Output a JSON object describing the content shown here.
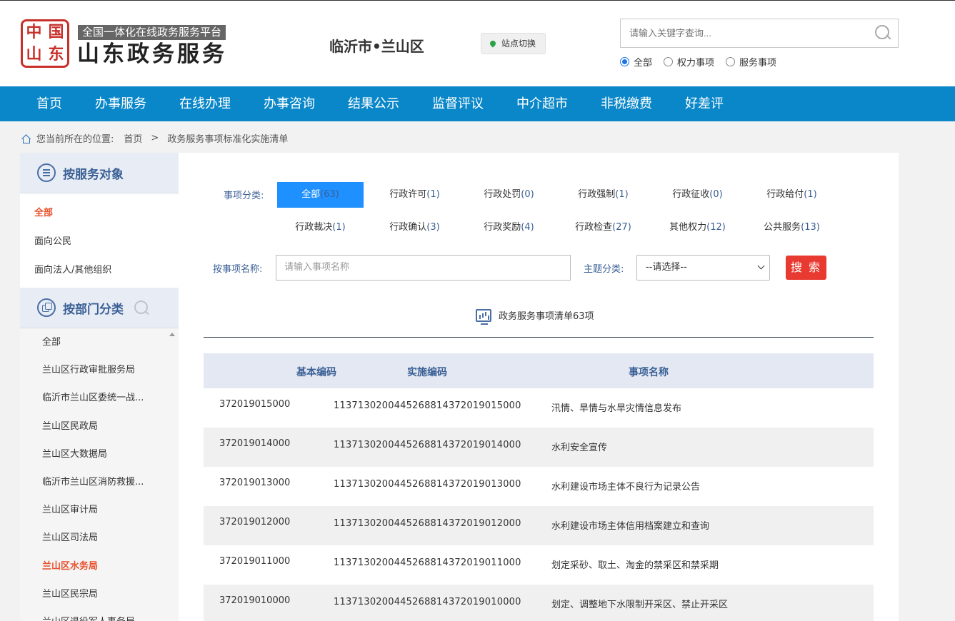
{
  "header": {
    "seal_chars": [
      "中",
      "国",
      "山",
      "东"
    ],
    "platform_subtitle": "全国一体化在线政务服务平台",
    "site_title": "山东政务服务",
    "region": "临沂市•兰山区",
    "switch_site": "站点切换",
    "search_placeholder": "请输入关键字查询...",
    "search_scope": [
      "全部",
      "权力事项",
      "服务事项"
    ],
    "search_scope_selected": "全部"
  },
  "nav": [
    "首页",
    "办事服务",
    "在线办理",
    "办事咨询",
    "结果公示",
    "监督评议",
    "中介超市",
    "非税缴费",
    "好差评"
  ],
  "breadcrumb": {
    "prefix": "您当前所在的位置:",
    "items": [
      "首页",
      "政务服务事项标准化实施清单"
    ],
    "separator": ">"
  },
  "sidebar": {
    "by_target_title": "按服务对象",
    "targets": [
      "全部",
      "面向公民",
      "面向法人/其他组织"
    ],
    "targets_active": "全部",
    "by_dept_title": "按部门分类",
    "departments": [
      "全部",
      "兰山区行政审批服务局",
      "临沂市兰山区委统一战...",
      "兰山区民政局",
      "兰山区大数据局",
      "临沂市兰山区消防救援...",
      "兰山区审计局",
      "兰山区司法局",
      "兰山区水务局",
      "兰山区民宗局",
      "兰山区退役军人事务局"
    ],
    "departments_active": "兰山区水务局"
  },
  "filters": {
    "category_label": "事项分类:",
    "categories": [
      {
        "name": "全部",
        "count": "(63)"
      },
      {
        "name": "行政许可",
        "count": "(1)"
      },
      {
        "name": "行政处罚",
        "count": "(0)"
      },
      {
        "name": "行政强制",
        "count": "(1)"
      },
      {
        "name": "行政征收",
        "count": "(0)"
      },
      {
        "name": "行政给付",
        "count": "(1)"
      },
      {
        "name": "行政裁决",
        "count": "(1)"
      },
      {
        "name": "行政确认",
        "count": "(3)"
      },
      {
        "name": "行政奖励",
        "count": "(4)"
      },
      {
        "name": "行政检查",
        "count": "(27)"
      },
      {
        "name": "其他权力",
        "count": "(12)"
      },
      {
        "name": "公共服务",
        "count": "(13)"
      }
    ],
    "name_label": "按事项名称:",
    "name_placeholder": "请输入事项名称",
    "theme_label": "主题分类:",
    "theme_selected": "--请选择--",
    "search_button": "搜 索"
  },
  "summary": "政务服务事项清单63项",
  "table": {
    "headers": [
      "基本编码",
      "实施编码",
      "事项名称"
    ],
    "rows": [
      [
        "372019015000",
        "11371302004452688143720190150​00",
        "汛情、旱情与水旱灾情信息发布"
      ],
      [
        "372019014000",
        "113713020044526881437201901400​0",
        "水利安全宣传"
      ],
      [
        "372019013000",
        "113713020044526881437201901300​0",
        "水利建设市场主体不良行为记录公告"
      ],
      [
        "372019012000",
        "113713020044526881437201901200​0",
        "水利建设市场主体信用档案建立和查询"
      ],
      [
        "372019011000",
        "113713020044526881437201901100​0",
        "划定采砂、取土、淘金的禁采区和禁采期"
      ],
      [
        "372019010000",
        "113713020044526881437201901000​0",
        "划定、调整地下水限制开采区、禁止开采区"
      ]
    ]
  }
}
